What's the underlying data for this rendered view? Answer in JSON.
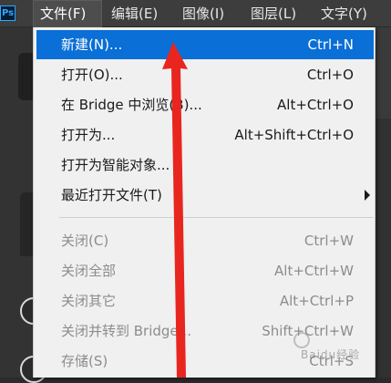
{
  "app": {
    "logo_text": "Ps",
    "accent": "#31a8ff"
  },
  "menubar": {
    "items": [
      {
        "label": "文件(F)"
      },
      {
        "label": "编辑(E)"
      },
      {
        "label": "图像(I)"
      },
      {
        "label": "图层(L)"
      },
      {
        "label": "文字(Y)"
      }
    ],
    "active_index": 0
  },
  "file_menu": {
    "highlight_color": "#0a6fd6",
    "items": [
      {
        "label": "新建(N)...",
        "shortcut": "Ctrl+N",
        "state": "highlighted"
      },
      {
        "label": "打开(O)...",
        "shortcut": "Ctrl+O",
        "state": "enabled"
      },
      {
        "label": "在 Bridge 中浏览(B)...",
        "shortcut": "Alt+Ctrl+O",
        "state": "enabled"
      },
      {
        "label": "打开为...",
        "shortcut": "Alt+Shift+Ctrl+O",
        "state": "enabled"
      },
      {
        "label": "打开为智能对象...",
        "shortcut": "",
        "state": "enabled"
      },
      {
        "label": "最近打开文件(T)",
        "shortcut": "",
        "state": "enabled",
        "submenu": true
      },
      {
        "label": "关闭(C)",
        "shortcut": "Ctrl+W",
        "state": "disabled"
      },
      {
        "label": "关闭全部",
        "shortcut": "Alt+Ctrl+W",
        "state": "disabled"
      },
      {
        "label": "关闭其它",
        "shortcut": "Alt+Ctrl+P",
        "state": "disabled"
      },
      {
        "label": "关闭并转到 Bridge...",
        "shortcut": "Shift+Ctrl+W",
        "state": "disabled"
      },
      {
        "label": "存储(S)",
        "shortcut": "Ctrl+S",
        "state": "disabled"
      }
    ]
  },
  "annotation": {
    "icon": "red-arrow-icon",
    "color": "#e8261f"
  },
  "watermark": {
    "icon": "baidu-paw-icon",
    "text": "Baidu经验"
  }
}
